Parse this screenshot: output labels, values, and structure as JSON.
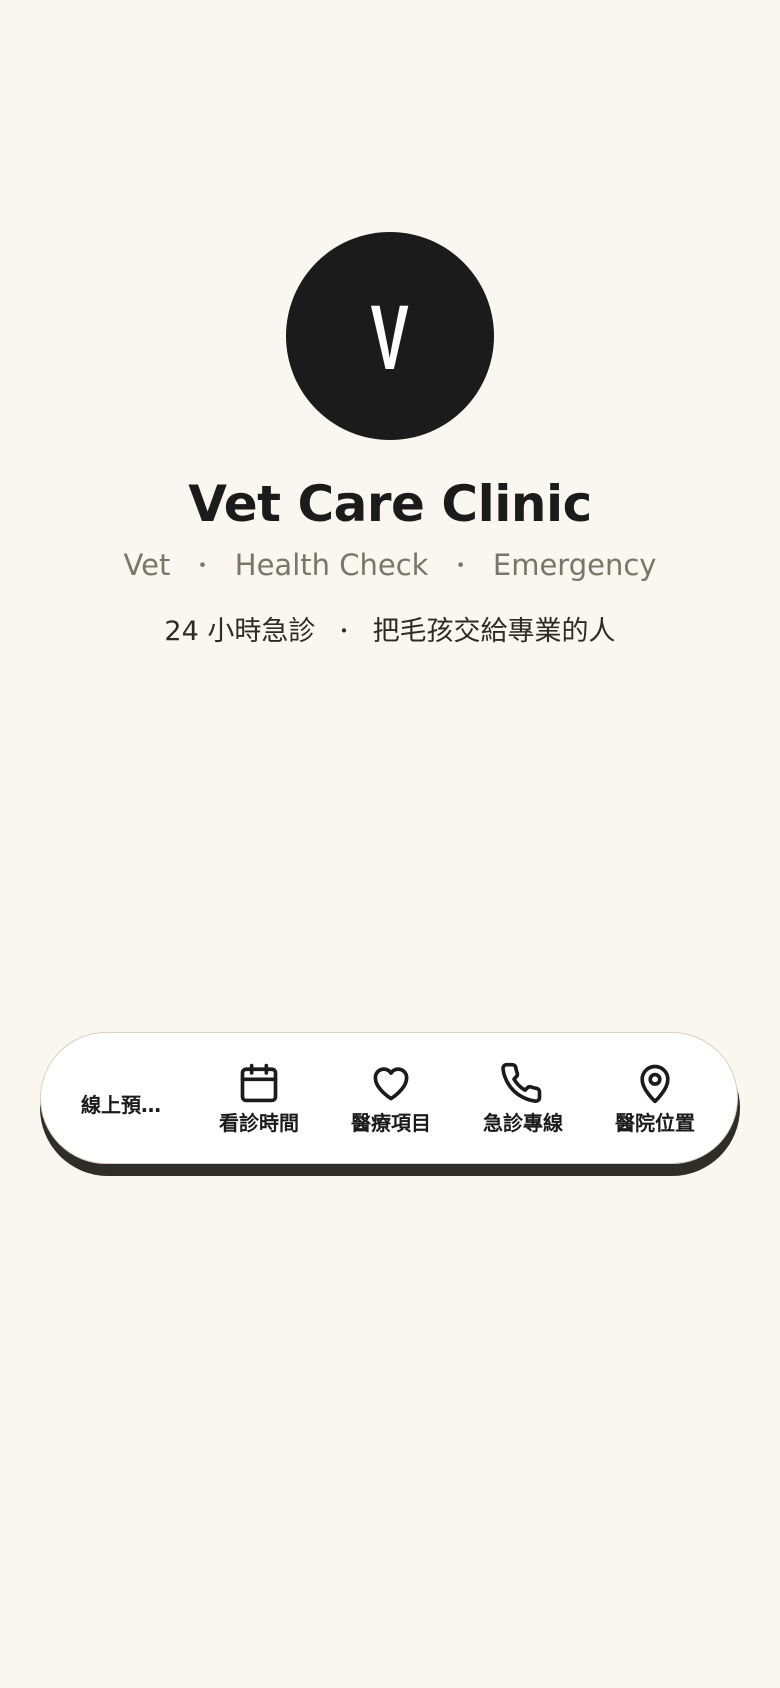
{
  "profile": {
    "avatar_letter": "V",
    "name": "Vet Care Clinic",
    "tags": [
      "Vet",
      "Health Check",
      "Emergency"
    ],
    "tag_separator": "・",
    "tagline_parts": [
      "24 小時急診",
      "把毛孩交給專業的人"
    ],
    "tagline_separator": "・"
  },
  "nav": {
    "first_label": "線上預…",
    "items": [
      {
        "label": "看診時間",
        "icon": "calendar-icon"
      },
      {
        "label": "醫療項目",
        "icon": "heart-icon"
      },
      {
        "label": "急診專線",
        "icon": "phone-icon"
      },
      {
        "label": "醫院位置",
        "icon": "map-pin-icon"
      }
    ]
  },
  "colors": {
    "background": "#f9f7f0",
    "avatar": "#1b1b1b",
    "muted_text": "#7a7568",
    "nav_background": "#ffffff",
    "nav_shadow": "#2f2d28"
  }
}
